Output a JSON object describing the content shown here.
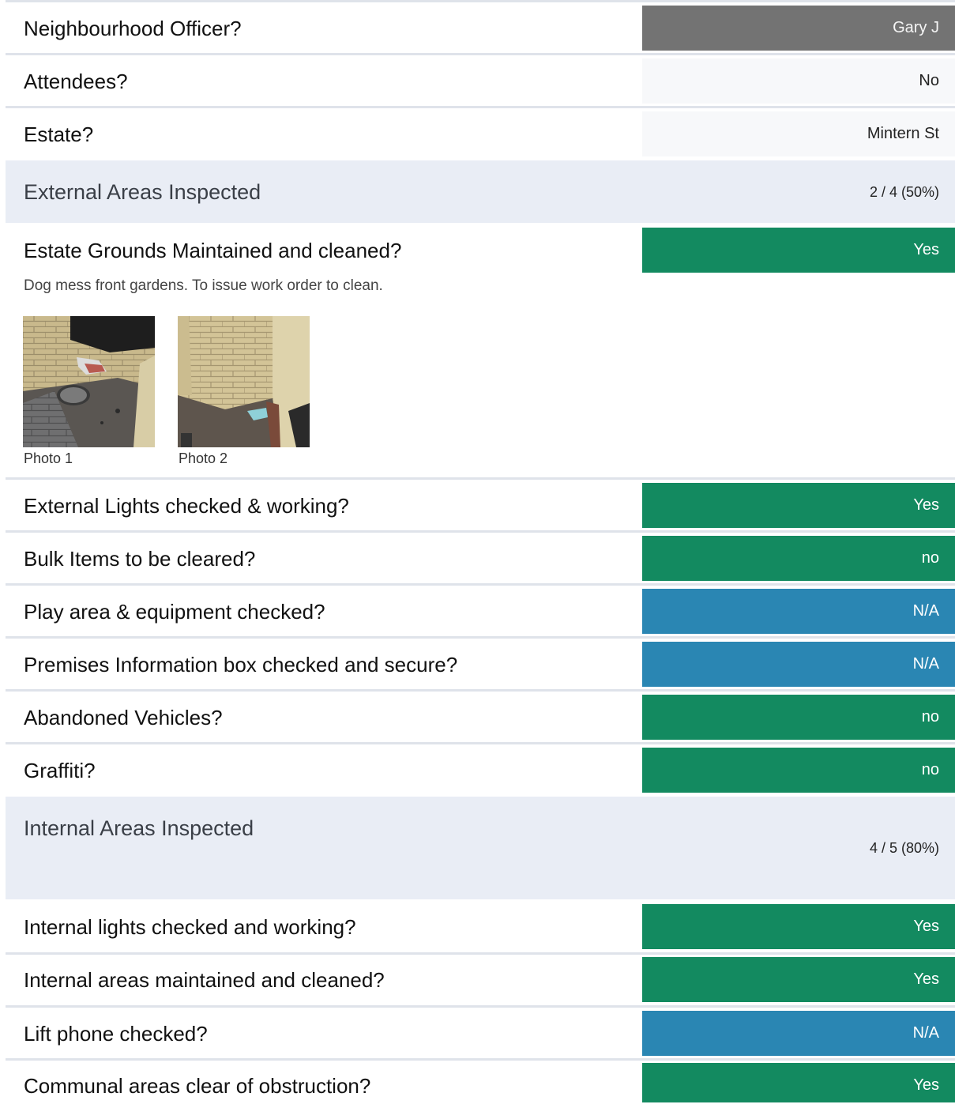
{
  "rows_top": [
    {
      "question": "Neighbourhood Officer?",
      "answer": "Gary J",
      "style": "grey"
    },
    {
      "question": "Attendees?",
      "answer": "No",
      "style": "light"
    },
    {
      "question": "Estate?",
      "answer": "Mintern St",
      "style": "light"
    }
  ],
  "external": {
    "title": "External Areas Inspected",
    "score": "2 / 4 (50%)",
    "first": {
      "question": "Estate Grounds Maintained and cleaned?",
      "answer": "Yes",
      "style": "green"
    },
    "note": "Dog mess front gardens.  To issue work order to clean.",
    "photos": [
      {
        "caption": "Photo 1"
      },
      {
        "caption": "Photo 2"
      }
    ],
    "items": [
      {
        "question": "External Lights checked & working?",
        "answer": "Yes",
        "style": "green"
      },
      {
        "question": "Bulk Items to be cleared?",
        "answer": "no",
        "style": "green"
      },
      {
        "question": "Play area & equipment checked?",
        "answer": "N/A",
        "style": "blue"
      },
      {
        "question": "Premises Information box checked and secure?",
        "answer": "N/A",
        "style": "blue"
      },
      {
        "question": "Abandoned Vehicles?",
        "answer": "no",
        "style": "green"
      },
      {
        "question": "Graffiti?",
        "answer": "no",
        "style": "green"
      }
    ]
  },
  "internal": {
    "title": "Internal Areas Inspected",
    "score": "4 / 5 (80%)",
    "items": [
      {
        "question": "Internal lights checked and working?",
        "answer": "Yes",
        "style": "green"
      },
      {
        "question": "Internal areas maintained and cleaned?",
        "answer": "Yes",
        "style": "green"
      },
      {
        "question": "Lift phone checked?",
        "answer": "N/A",
        "style": "blue"
      },
      {
        "question": "Communal areas clear of obstruction?",
        "answer": "Yes",
        "style": "green"
      }
    ]
  },
  "colors": {
    "yes_green": "#138a60",
    "na_blue": "#2a86b3",
    "officer_grey": "#737373",
    "section_bg": "#e9edf5"
  }
}
